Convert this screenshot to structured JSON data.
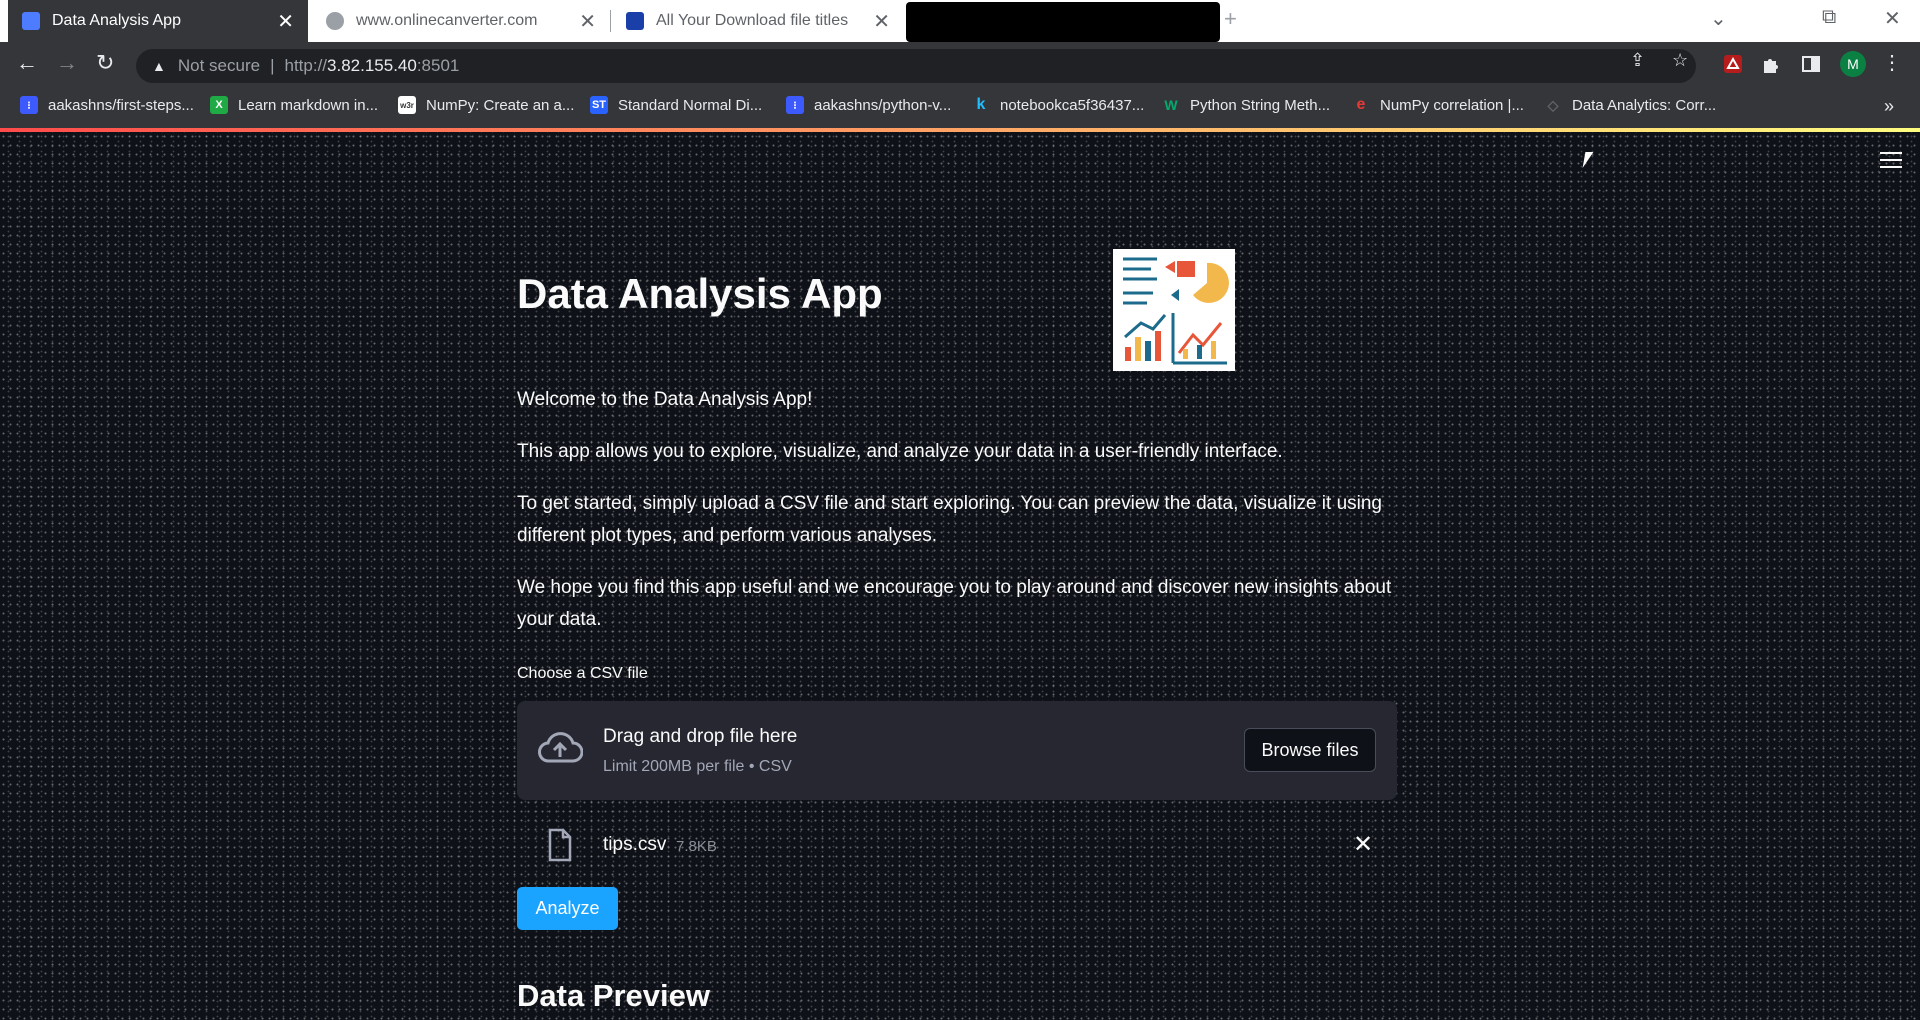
{
  "browser": {
    "tabs": [
      {
        "title": "Data Analysis App"
      },
      {
        "title": "www.onlinecanverter.com"
      },
      {
        "title": "All Your Download file titles"
      }
    ],
    "address": {
      "security_label": "Not secure",
      "url_scheme": "http://",
      "url_host": "3.82.155.40",
      "url_port": ":8501"
    },
    "profile_initial": "M",
    "bookmarks": [
      {
        "label": "aakashns/first-steps...",
        "icon": "jovian-icon",
        "color": "#3d5afe"
      },
      {
        "label": "Learn markdown in...",
        "icon": "x-icon",
        "color": "#1faa45"
      },
      {
        "label": "NumPy: Create an a...",
        "icon": "w3r-icon",
        "color": "#ffffff"
      },
      {
        "label": "Standard Normal Di...",
        "icon": "st-icon",
        "color": "#2962ff"
      },
      {
        "label": "aakashns/python-v...",
        "icon": "jovian-icon",
        "color": "#3d5afe"
      },
      {
        "label": "notebookca5f36437...",
        "icon": "kaggle-icon",
        "color": "#20beff"
      },
      {
        "label": "Python String Meth...",
        "icon": "w3-icon",
        "color": "#04aa6d"
      },
      {
        "label": "NumPy correlation |...",
        "icon": "realpython-icon",
        "color": "#e53935"
      },
      {
        "label": "Data Analytics: Corr...",
        "icon": "cloud-icon",
        "color": "#5f6368"
      }
    ],
    "bookmarks_more": "»"
  },
  "app": {
    "title": "Data Analysis App",
    "paragraphs": [
      "Welcome to the Data Analysis App!",
      "This app allows you to explore, visualize, and analyze your data in a user-friendly interface.",
      "To get started, simply upload a CSV file and start exploring. You can preview the data, visualize it using different plot types, and perform various analyses.",
      "We hope you find this app useful and we encourage you to play around and discover new insights about your data."
    ],
    "uploader": {
      "label": "Choose a CSV file",
      "drop_title": "Drag and drop file here",
      "drop_subtitle": "Limit 200MB per file • CSV",
      "browse_label": "Browse files"
    },
    "uploaded_file": {
      "name": "tips.csv",
      "size": "7.8KB"
    },
    "analyze_label": "Analyze",
    "section_title": "Data Preview"
  },
  "colors": {
    "background": "#0e1117",
    "primary_button": "#1aa3ff",
    "dropzone": "#262730"
  }
}
